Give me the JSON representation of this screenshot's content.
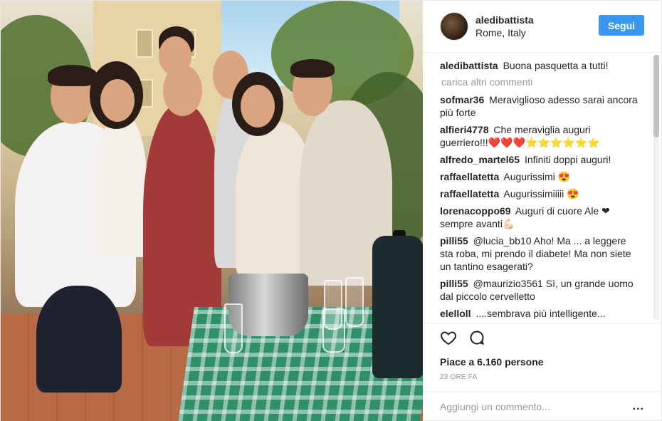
{
  "header": {
    "username": "aledibattista",
    "location": "Rome, Italy",
    "follow_label": "Segui"
  },
  "caption": {
    "user": "aledibattista",
    "text": "Buona pasquetta a tutti!"
  },
  "load_more_label": "carica altri commenti",
  "comments": [
    {
      "user": "sofmar36",
      "text": "Meraviglioso adesso sarai ancora più forte"
    },
    {
      "user": "alfieri4778",
      "text": "Che meraviglia auguri guerriero!!!❤️❤️❤️⭐⭐⭐⭐⭐⭐"
    },
    {
      "user": "alfredo_martel65",
      "text": "Infiniti doppi auguri!"
    },
    {
      "user": "raffaellatetta",
      "text": "Augurissimi 😍"
    },
    {
      "user": "raffaellatetta",
      "text": "Augurissimiiiii 😍"
    },
    {
      "user": "lorenacoppo69",
      "text": "Auguri di cuore Ale ❤ sempre avanti💪🏻"
    },
    {
      "user": "pilli55",
      "text": "@lucia_bb10 Aho! Ma ... a leggere sta roba, mi prendo il diabete! Ma non siete un tantino esagerati?"
    },
    {
      "user": "pilli55",
      "text": "@maurizio3561 Sì, un grande uomo dal piccolo cervelletto"
    },
    {
      "user": "elelloll",
      "text": "....sembrava più intelligente..."
    }
  ],
  "actions": {
    "like_icon": "heart-icon",
    "comment_icon": "comment-icon"
  },
  "likes_text": "Piace a 6.160 persone",
  "time_text": "23 ORE FA",
  "add_comment": {
    "placeholder": "Aggiungi un commento...",
    "more_label": "..."
  }
}
